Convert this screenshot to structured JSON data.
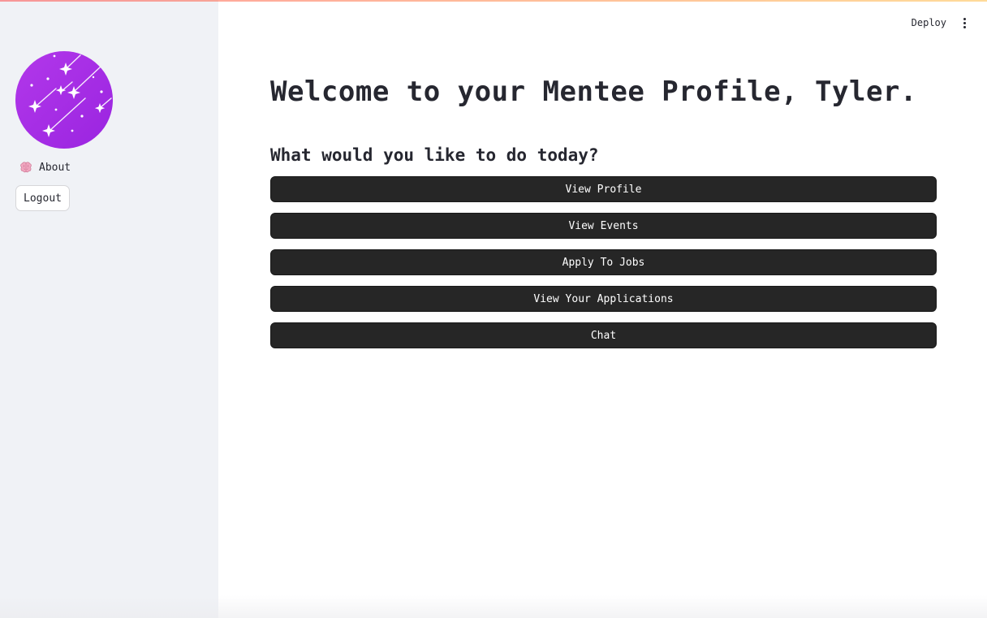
{
  "sidebar": {
    "logo_icon": "shooting-stars-logo",
    "logo_color": "#a02ee6",
    "nav": [
      {
        "icon": "brain-icon",
        "label": "About"
      }
    ],
    "logout_label": "Logout"
  },
  "header": {
    "deploy_label": "Deploy",
    "menu_icon": "kebab-menu-icon"
  },
  "main": {
    "title": "Welcome to your Mentee Profile, Tyler.",
    "subtitle": "What would you like to do today?",
    "actions": [
      {
        "label": "View Profile"
      },
      {
        "label": "View Events"
      },
      {
        "label": "Apply To Jobs"
      },
      {
        "label": "View Your Applications"
      },
      {
        "label": "Chat"
      }
    ]
  },
  "colors": {
    "sidebar_bg": "#f0f2f6",
    "button_bg": "#262626",
    "text": "#262730"
  }
}
